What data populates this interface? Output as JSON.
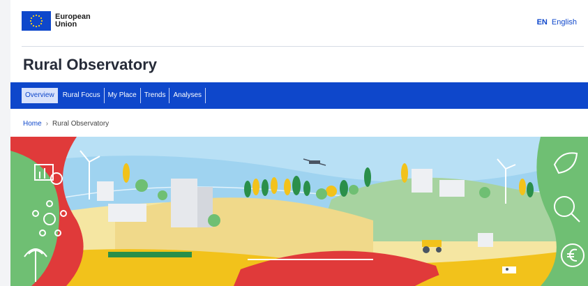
{
  "header": {
    "logo_line1": "European",
    "logo_line2": "Union",
    "lang_code": "EN",
    "lang_name": "English"
  },
  "site": {
    "title": "Rural Observatory"
  },
  "nav": {
    "items": [
      "Overview",
      "Rural Focus",
      "My Place",
      "Trends",
      "Analyses"
    ],
    "active": "Overview"
  },
  "breadcrumb": {
    "home": "Home",
    "separator": "›",
    "current": "Rural Observatory"
  },
  "colors": {
    "brand_blue": "#0e47cb",
    "nav_active_bg": "#d8e2fb",
    "title_text": "#262b38",
    "hero_sky": "#9fd3f0",
    "hero_green": "#6fbf73",
    "hero_red": "#e03a3a",
    "hero_yellow": "#f2c21b"
  },
  "icons": [
    "eu-flag-icon",
    "chart-clock-icon",
    "network-icon",
    "antenna-icon",
    "leaf-icon",
    "magnifier-icon",
    "euro-sprout-icon"
  ]
}
